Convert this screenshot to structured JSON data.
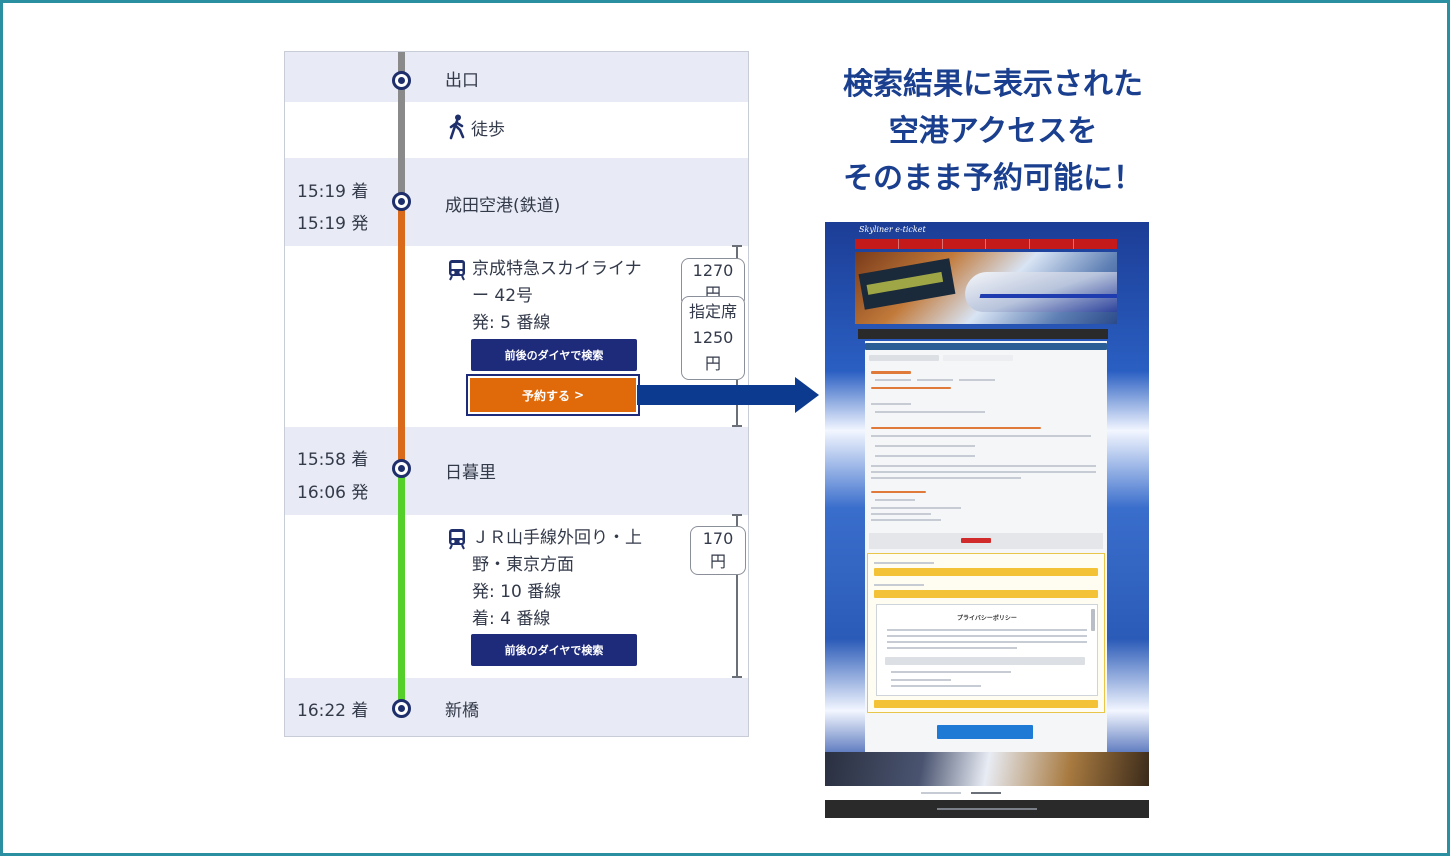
{
  "headline": {
    "line1": "検索結果に表示された",
    "line2": "空港アクセスを",
    "line3": "そのまま予約可能に！"
  },
  "route": {
    "exit": {
      "label": "出口"
    },
    "walk": {
      "label": "徒歩",
      "icon": "walking-person-icon"
    },
    "narita": {
      "arrive": "15:19 着",
      "depart": "15:19 発",
      "station": "成田空港(鉄道)"
    },
    "skyliner": {
      "icon": "train-icon",
      "name_line1": "京成特急スカイライナ",
      "name_line2": "ー 42号",
      "platform": "発: 5 番線",
      "fare": "1270円",
      "reserved_label": "指定席",
      "reserved_fare": "1250円",
      "search_button": "前後のダイヤで検索",
      "reserve_button": "予約する",
      "reserve_chevron": ">",
      "line_color": "#d96a1c"
    },
    "nippori": {
      "arrive": "15:58 着",
      "depart": "16:06 発",
      "station": "日暮里"
    },
    "yamanote": {
      "icon": "train-icon",
      "name_line1": "ＪＲ山手線外回り・上",
      "name_line2": "野・東京方面",
      "depart_platform": "発: 10 番線",
      "arrive_platform": "着: 4 番線",
      "fare": "170円",
      "search_button": "前後のダイヤで検索",
      "line_color": "#55d02a"
    },
    "shimbashi": {
      "arrive": "16:22 着",
      "station": "新橋"
    },
    "walk_line_color": "#8a8a8a"
  },
  "website": {
    "logo": "Skyliner e-ticket",
    "privacy_title": "プライバシーポリシー"
  },
  "colors": {
    "accent_navy": "#1e2a7a",
    "reserve_orange": "#e06a0a",
    "headline_blue": "#1a3f8f",
    "arrow_blue": "#0b3a8f",
    "frame_teal": "#2a8fa0"
  }
}
